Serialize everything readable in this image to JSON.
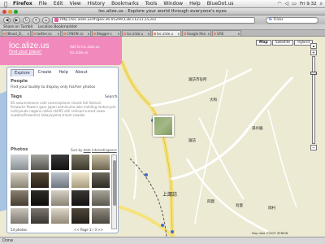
{
  "menubar": {
    "app": "Firefox",
    "items": [
      "File",
      "Edit",
      "View",
      "History",
      "Bookmarks",
      "Tools",
      "Window",
      "Help",
      "BlueDot.us"
    ],
    "clock": "Fri 9:32"
  },
  "window": {
    "title": "loc.alize.us - Explore your world through everyone's eyes"
  },
  "nav": {
    "url": "http://loc.alize.us/#/geo:36.05299,138.11211,15,ev/",
    "search_placeholder": "Flickr"
  },
  "bookmarks": [
    "Share on Tumblr",
    "Localize Bookmarklet"
  ],
  "tabs": [
    {
      "label": "[Blood_D...",
      "active": false
    },
    {
      "label": "twitter.co",
      "active": false
    },
    {
      "label": "CANON co",
      "active": false
    },
    {
      "label": "Blogger-c",
      "active": false
    },
    {
      "label": "loc.alize.u",
      "active": false
    },
    {
      "label": "loc.alize.u",
      "active": true
    },
    {
      "label": "Google Rea",
      "active": false
    },
    {
      "label": "GRE",
      "active": false
    }
  ],
  "header": {
    "logo": "loc.alize.us",
    "find_place": "Find your place!",
    "add_link": "Add to loc.alize.us",
    "add_link2": "loc.alize.us"
  },
  "sidebar": {
    "tabs": [
      "Explore",
      "Create",
      "Help",
      "About"
    ],
    "people_title": "People",
    "people_text": "Find your buddy to display only his/her photos",
    "tags_title": "Tags",
    "search_label": "Search",
    "tags_text": "60 autumnleaves cafe cameraphone clouds fall festival fireworks flowers gass japan kaminuma lake melding motorcycle nichiyoudo nagano nikkei nk005 ohli railroad sunset suwa suwako(fireworks) takayoyama travel suwako",
    "photos_title": "Photos",
    "sort_label": "Sort by",
    "sort_value": "date",
    "sort_alt": "interestingness",
    "count": "54 photos",
    "pager": "<< Page 1 / 3 >>"
  },
  "map": {
    "types": [
      "Map",
      "Satellite",
      "Hybrid"
    ],
    "active_type": "Map",
    "copyright": "Map data ©2007 ZENRIN",
    "labels": [
      "諏訪市役所",
      "大和",
      "諏訪",
      "上諏訪",
      "四賀",
      "有賀",
      "岡村",
      "湯の脇",
      "諏訪湖"
    ]
  },
  "status": "Done",
  "colors": {
    "brand_pink": "#f289bd",
    "map_bg": "#ecead3",
    "road_yellow": "#f6e27a",
    "water": "#a8c4e0"
  }
}
